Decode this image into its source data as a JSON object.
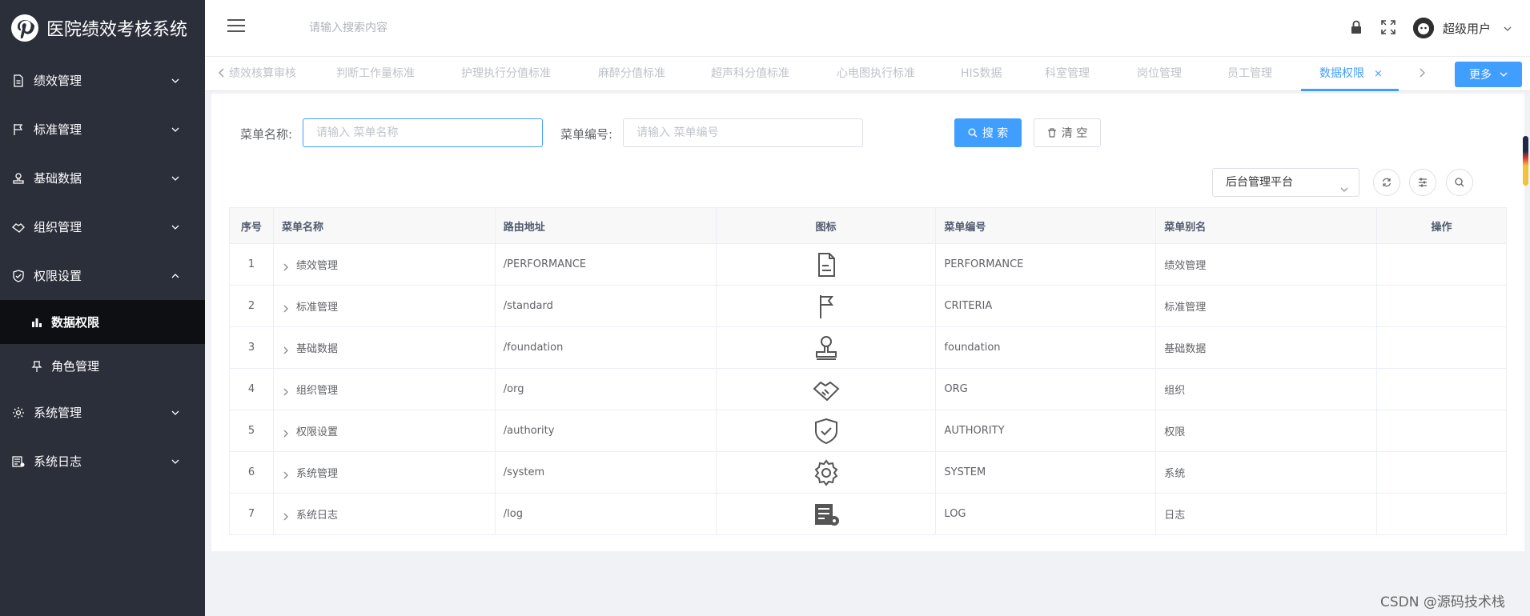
{
  "app": {
    "title": "医院绩效考核系统",
    "accent_color": "#409eff",
    "sidebar_bg": "#2b2f3a"
  },
  "sidebar": {
    "items": [
      {
        "label": "绩效管理",
        "icon": "document-icon",
        "expanded": false
      },
      {
        "label": "标准管理",
        "icon": "flag-icon",
        "expanded": false
      },
      {
        "label": "基础数据",
        "icon": "stamp-icon",
        "expanded": false
      },
      {
        "label": "组织管理",
        "icon": "handshake-icon",
        "expanded": false
      },
      {
        "label": "权限设置",
        "icon": "shield-check-icon",
        "expanded": true
      },
      {
        "label": "系统管理",
        "icon": "gear-icon",
        "expanded": false
      },
      {
        "label": "系统日志",
        "icon": "log-icon",
        "expanded": false
      }
    ],
    "sub_items": [
      {
        "label": "数据权限",
        "icon": "bar-chart-icon",
        "active": true
      },
      {
        "label": "角色管理",
        "icon": "pin-icon",
        "active": false
      }
    ]
  },
  "header": {
    "search_placeholder": "请输入搜索内容",
    "user_name": "超级用户"
  },
  "tabs": {
    "items": [
      {
        "label": "绩效核算审核",
        "active": false
      },
      {
        "label": "判断工作量标准",
        "active": false
      },
      {
        "label": "护理执行分值标准",
        "active": false
      },
      {
        "label": "麻醉分值标准",
        "active": false
      },
      {
        "label": "超声科分值标准",
        "active": false
      },
      {
        "label": "心电图执行标准",
        "active": false
      },
      {
        "label": "HIS数据",
        "active": false
      },
      {
        "label": "科室管理",
        "active": false
      },
      {
        "label": "岗位管理",
        "active": false
      },
      {
        "label": "员工管理",
        "active": false
      },
      {
        "label": "数据权限",
        "active": true
      }
    ],
    "close_glyph": "×",
    "more_label": "更多"
  },
  "search_form": {
    "menu_name_label": "菜单名称:",
    "menu_name_placeholder": "请输入 菜单名称",
    "menu_code_label": "菜单编号:",
    "menu_code_placeholder": "请输入 菜单编号",
    "search_button": "搜 索",
    "clear_button": "清 空"
  },
  "toolbar": {
    "platform_selected": "后台管理平台"
  },
  "table": {
    "columns": [
      "序号",
      "菜单名称",
      "路由地址",
      "图标",
      "菜单编号",
      "菜单别名",
      "操作"
    ],
    "rows": [
      {
        "index": "1",
        "name": "绩效管理",
        "route": "/PERFORMANCE",
        "icon": "document-icon",
        "code": "PERFORMANCE",
        "alias": "绩效管理"
      },
      {
        "index": "2",
        "name": "标准管理",
        "route": "/standard",
        "icon": "flag-icon",
        "code": "CRITERIA",
        "alias": "标准管理"
      },
      {
        "index": "3",
        "name": "基础数据",
        "route": "/foundation",
        "icon": "stamp-icon",
        "code": "foundation",
        "alias": "基础数据"
      },
      {
        "index": "4",
        "name": "组织管理",
        "route": "/org",
        "icon": "handshake-icon",
        "code": "ORG",
        "alias": "组织"
      },
      {
        "index": "5",
        "name": "权限设置",
        "route": "/authority",
        "icon": "shield-check-icon",
        "code": "AUTHORITY",
        "alias": "权限"
      },
      {
        "index": "6",
        "name": "系统管理",
        "route": "/system",
        "icon": "gear-icon",
        "code": "SYSTEM",
        "alias": "系统"
      },
      {
        "index": "7",
        "name": "系统日志",
        "route": "/log",
        "icon": "log-icon",
        "code": "LOG",
        "alias": "日志"
      }
    ]
  },
  "watermark": "CSDN @源码技术栈"
}
